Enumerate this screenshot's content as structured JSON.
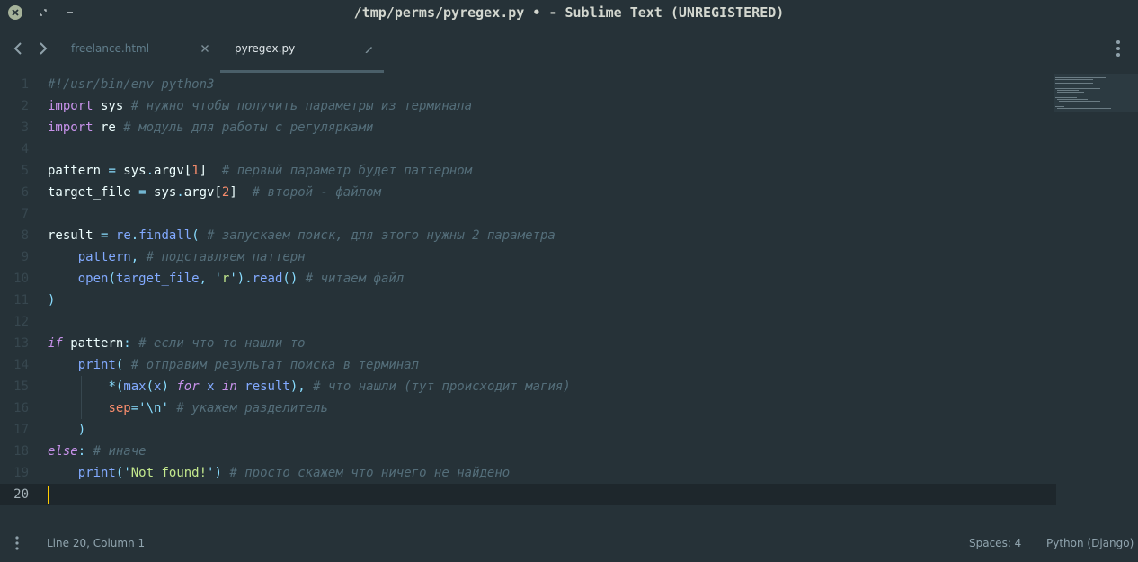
{
  "window": {
    "title": "/tmp/perms/pyregex.py • - Sublime Text (UNREGISTERED)"
  },
  "tabs": [
    {
      "label": "freelance.html",
      "active": false
    },
    {
      "label": "pyregex.py",
      "active": true
    }
  ],
  "editor": {
    "language": "python",
    "line_numbers": [
      "1",
      "2",
      "3",
      "4",
      "5",
      "6",
      "7",
      "8",
      "9",
      "10",
      "11",
      "12",
      "13",
      "14",
      "15",
      "16",
      "17",
      "18",
      "19",
      "20"
    ],
    "current_line": "20",
    "lines": [
      "#!/usr/bin/env python3",
      "import sys # нужно чтобы получить параметры из терминала",
      "import re # модуль для работы с регулярками",
      "",
      "pattern = sys.argv[1]  # первый параметр будет паттерном",
      "target_file = sys.argv[2]  # второй - файлом",
      "",
      "result = re.findall( # запускаем поиск, для этого нужны 2 параметра",
      "    pattern, # подставляем паттерн",
      "    open(target_file, 'r').read() # читаем файл",
      ")",
      "",
      "if pattern: # если что то нашли то",
      "    print( # отправим результат поиска в терминал",
      "        *(max(x) for x in result), # что нашли (тут происходит магия)",
      "        sep='\\n' # укажем разделитель",
      "    )",
      "else: # иначе",
      "    print('Not found!') # просто скажем что ничего не найдено",
      ""
    ]
  },
  "status_bar": {
    "position": "Line 20, Column 1",
    "indentation": "Spaces: 4",
    "syntax": "Python (Django)"
  },
  "colors": {
    "background": "#263238",
    "keyword": "#c792ea",
    "function": "#82aaff",
    "string": "#c3e88d",
    "number": "#f78c6c",
    "comment": "#546e7a",
    "caret": "#ffcc00"
  },
  "icons": [
    "close-window-icon",
    "restore-window-icon",
    "minimize-window-icon",
    "chevron-left-icon",
    "chevron-right-icon",
    "tab-close-icon",
    "pencil-icon",
    "vertical-dots-icon"
  ]
}
